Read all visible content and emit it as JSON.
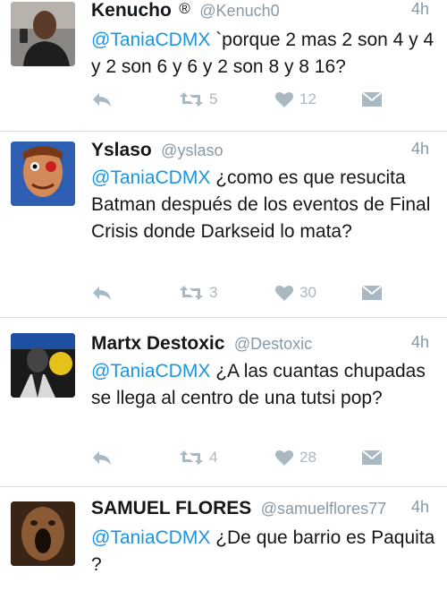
{
  "colors": {
    "mention": "#1b95e0",
    "meta": "#8899a6",
    "action": "#aab8c2",
    "separator": "#d8dde2"
  },
  "tweets": [
    {
      "name": "Kenucho",
      "badge": "®",
      "handle": "@Kenuch0",
      "time": "4h",
      "mention": "@TaniaCDMX",
      "text": " `porque 2 mas 2 son 4 y 4 y 2 son 6 y 6 y 2 son 8 y 8 16?",
      "retweets": "5",
      "likes": "12"
    },
    {
      "name": "Yslaso",
      "handle": "@yslaso",
      "time": "4h",
      "mention": "@TaniaCDMX",
      "text": " ¿como es que resucita Batman después de los eventos de Final Crisis donde Darkseid lo mata?",
      "retweets": "3",
      "likes": "30"
    },
    {
      "name": "Martx Destoxic",
      "handle": "@Destoxic",
      "time": "4h",
      "mention": "@TaniaCDMX",
      "text": " ¿A las cuantas chupadas se llega al centro de una tutsi pop?",
      "retweets": "4",
      "likes": "28"
    },
    {
      "name": "SAMUEL FLORES",
      "handle": "@samuelflores77",
      "time": "4h",
      "mention": "@TaniaCDMX",
      "text": " ¿De que barrio es Paquita ?"
    }
  ]
}
